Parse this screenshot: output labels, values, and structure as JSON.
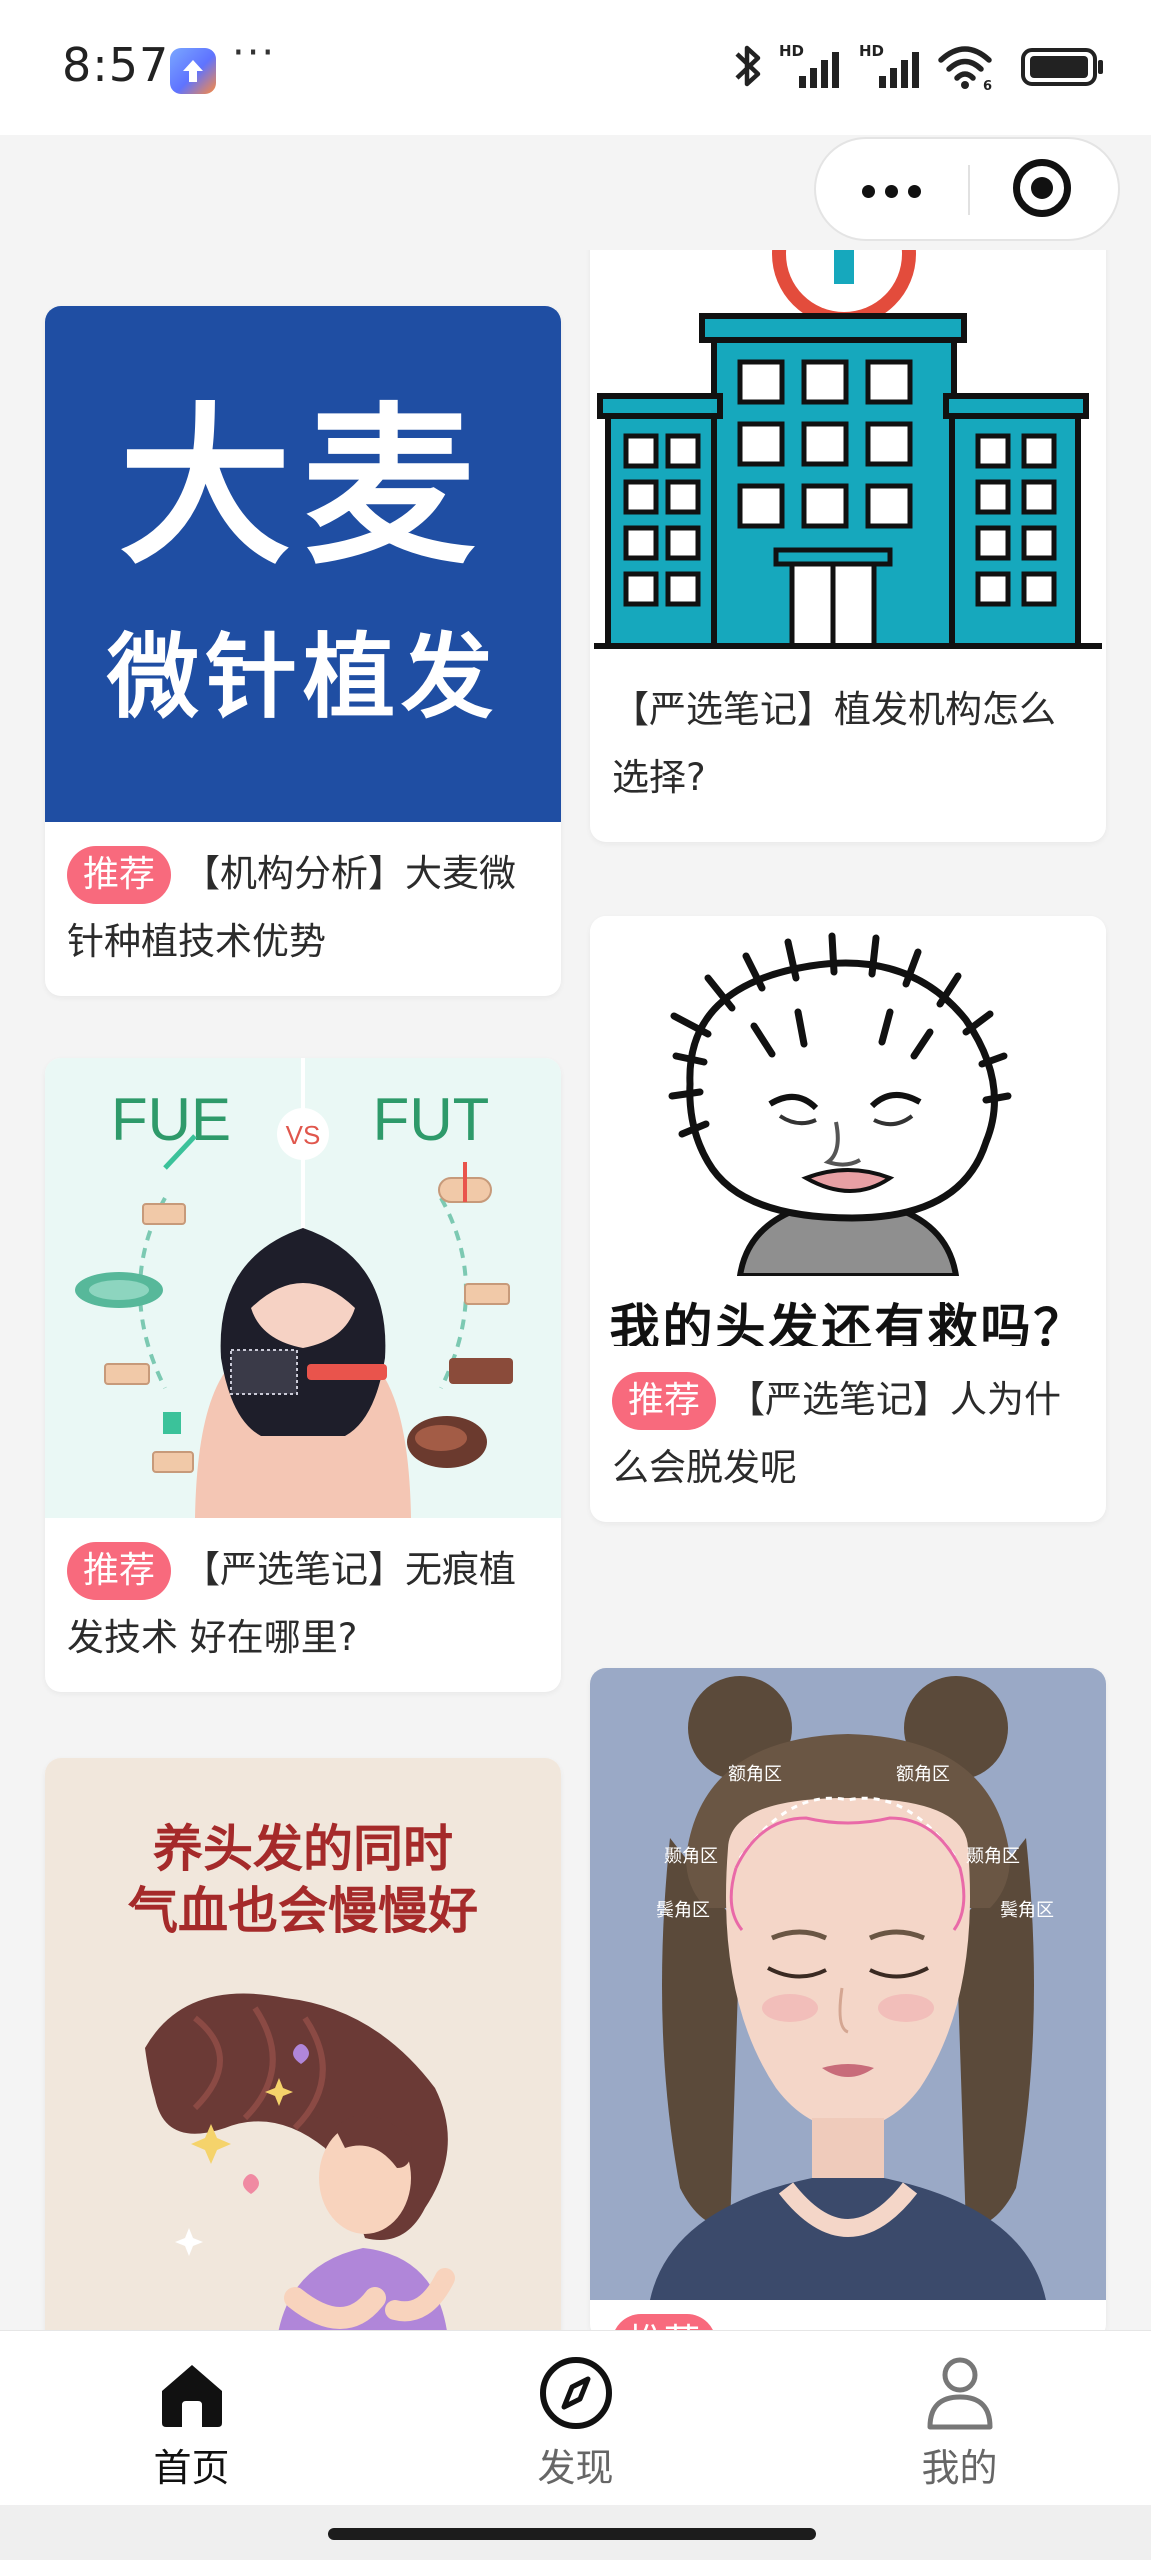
{
  "status_bar": {
    "time": "8:57",
    "more": "···",
    "icons": [
      "app-upload-icon",
      "bluetooth-icon",
      "signal-hd-1-icon",
      "signal-hd-2-icon",
      "wifi-icon",
      "battery-icon"
    ],
    "network_badge_1": "HD",
    "network_badge_2": "HD",
    "wifi_badge": "6"
  },
  "capsule": {
    "icons": [
      "more-dots-icon",
      "close-target-icon"
    ]
  },
  "feed": {
    "tag_label": "推荐",
    "cards": [
      {
        "column": "left",
        "image_title": "大麦",
        "image_subtitle": "微针植发",
        "tag": "推荐",
        "caption": "【机构分析】大麦微针种植技术优势"
      },
      {
        "column": "right",
        "image": "hospital-building",
        "caption": "【严选笔记】植发机构怎么选择?"
      },
      {
        "column": "left",
        "image_left_label": "FUE",
        "image_vs_label": "VS",
        "image_right_label": "FUT",
        "tag": "推荐",
        "caption": "【严选笔记】无痕植发技术 好在哪里?"
      },
      {
        "column": "right",
        "image_text": "我的头发还有救吗？",
        "tag": "推荐",
        "caption": "【严选笔记】人为什么会脱发呢"
      },
      {
        "column": "left",
        "image_line_1": "养头发的同时",
        "image_line_2": "气血也会慢慢好"
      },
      {
        "column": "right",
        "image_labels": [
          "额角区",
          "额角区",
          "颞角区",
          "颞角区",
          "鬓角区",
          "鬓角区"
        ]
      }
    ]
  },
  "tabbar": {
    "tabs": [
      {
        "label": "首页",
        "icon": "home-icon",
        "active": true
      },
      {
        "label": "发现",
        "icon": "compass-icon",
        "active": false
      },
      {
        "label": "我的",
        "icon": "user-icon",
        "active": false
      }
    ]
  },
  "colors": {
    "accent_tag": "#f86a7d",
    "brand_blue": "#1f4ea3",
    "hospital_teal": "#16a8bd"
  }
}
